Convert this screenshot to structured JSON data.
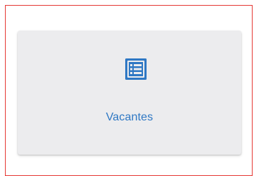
{
  "tile": {
    "label": "Vacantes",
    "icon": "list-icon"
  },
  "colors": {
    "accent": "#2f78c4",
    "tile_bg": "#ececee",
    "frame_border": "#e53935"
  }
}
